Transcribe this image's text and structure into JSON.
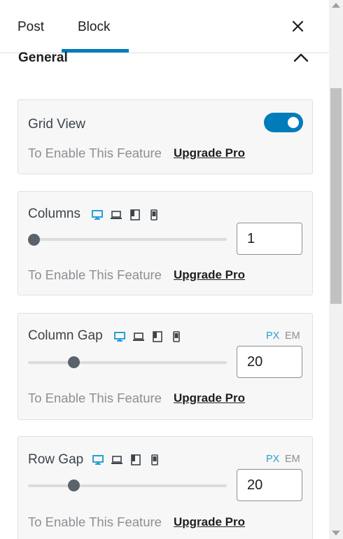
{
  "tabs": {
    "post": "Post",
    "block": "Block"
  },
  "section": {
    "title": "General"
  },
  "upgrade": {
    "text": "To Enable This Feature",
    "link": "Upgrade Pro"
  },
  "grid_view": {
    "label": "Grid View",
    "enabled": true
  },
  "columns": {
    "label": "Columns",
    "value": "1",
    "slider_fraction": 0.0
  },
  "column_gap": {
    "label": "Column Gap",
    "value": "20",
    "unit_px": "PX",
    "unit_em": "EM",
    "active_unit": "PX",
    "slider_fraction": 0.2
  },
  "row_gap": {
    "label": "Row Gap",
    "value": "20",
    "unit_px": "PX",
    "unit_em": "EM",
    "active_unit": "PX",
    "slider_fraction": 0.2
  },
  "device_icons": [
    "desktop-icon",
    "laptop-icon",
    "tablet-icon",
    "mobile-icon"
  ],
  "colors": {
    "accent": "#007cba",
    "active_device": "#2aa0d4",
    "inactive_device": "#3c434a"
  }
}
